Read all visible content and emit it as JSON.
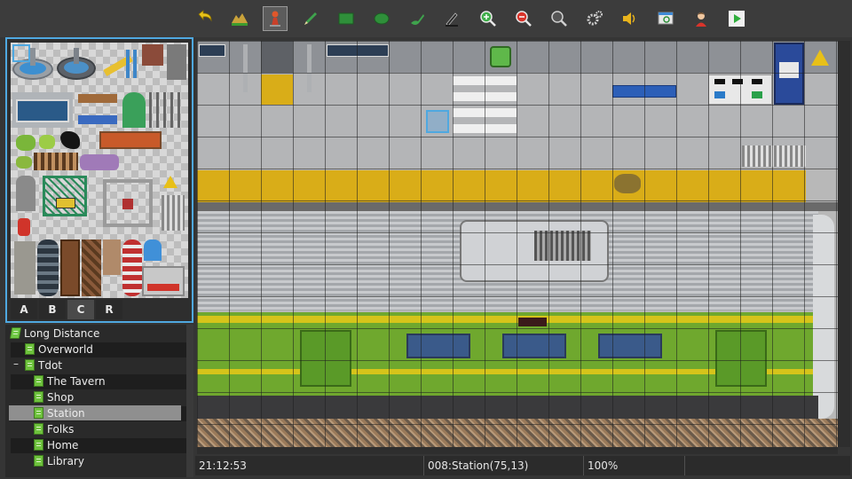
{
  "toolbar": {
    "buttons": [
      {
        "name": "undo",
        "icon": "undo-arrow-icon"
      },
      {
        "name": "map-layer",
        "icon": "map-layer-icon"
      },
      {
        "name": "event-layer",
        "icon": "event-pawn-icon",
        "active": true
      },
      {
        "name": "pencil",
        "icon": "pencil-icon"
      },
      {
        "name": "rectangle",
        "icon": "rectangle-icon"
      },
      {
        "name": "ellipse",
        "icon": "ellipse-icon"
      },
      {
        "name": "fill",
        "icon": "fill-bucket-icon"
      },
      {
        "name": "shadow-pen",
        "icon": "shadow-pen-icon"
      },
      {
        "name": "zoom-in",
        "icon": "zoom-in-icon"
      },
      {
        "name": "zoom-out",
        "icon": "zoom-out-icon"
      },
      {
        "name": "actual-size",
        "icon": "actual-size-icon"
      },
      {
        "name": "database",
        "icon": "gears-icon"
      },
      {
        "name": "sound-test",
        "icon": "speaker-icon"
      },
      {
        "name": "event-searcher",
        "icon": "search-window-icon"
      },
      {
        "name": "character-generator",
        "icon": "character-icon"
      },
      {
        "name": "playtest",
        "icon": "play-icon"
      }
    ]
  },
  "palette": {
    "tabs": [
      "A",
      "B",
      "C",
      "R"
    ],
    "active_tab": "C"
  },
  "map_tree": {
    "nodes": [
      {
        "label": "Long Distance",
        "level": 0,
        "root": true
      },
      {
        "label": "Overworld",
        "level": 1
      },
      {
        "label": "Tdot",
        "level": 1,
        "expanded": true
      },
      {
        "label": "The Tavern",
        "level": 2
      },
      {
        "label": "Shop",
        "level": 2
      },
      {
        "label": "Station",
        "level": 2,
        "selected": true
      },
      {
        "label": "Folks",
        "level": 2
      },
      {
        "label": "Home",
        "level": 2
      },
      {
        "label": "Library",
        "level": 2
      }
    ],
    "collapse_symbol": "–"
  },
  "status": {
    "time": "21:12:53",
    "map_info": "008:Station(75,13)",
    "zoom": "100%"
  },
  "colors": {
    "selection": "#4fa8e0",
    "tactile_strip": "#d9ad18",
    "train_green": "#6fa82e",
    "train_yellow": "#d6c41a"
  }
}
